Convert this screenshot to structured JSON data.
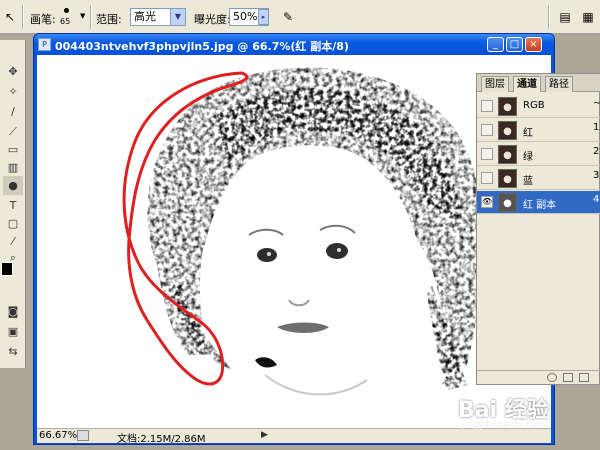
{
  "options_bar": {
    "brush_label": "画笔:",
    "brush_size": "65",
    "range_label": "范围:",
    "range_value": "高光",
    "exposure_label": "曝光度:",
    "exposure_value": "50%"
  },
  "document": {
    "title": "004403ntvehvf3phpvjln5.jpg @ 66.7%(红 副本/8)",
    "zoom": "66.67%",
    "doc_size": "文档:2.15M/2.86M"
  },
  "channels_panel": {
    "tabs": [
      {
        "label": "图层"
      },
      {
        "label": "通道"
      },
      {
        "label": "路径"
      }
    ],
    "active_tab": "通道",
    "channels": [
      {
        "name": "RGB",
        "shortcut": "~",
        "visible": false,
        "selected": false
      },
      {
        "name": "红",
        "shortcut": "1",
        "visible": false,
        "selected": false
      },
      {
        "name": "绿",
        "shortcut": "2",
        "visible": false,
        "selected": false
      },
      {
        "name": "蓝",
        "shortcut": "3",
        "visible": false,
        "selected": false
      },
      {
        "name": "红 副本",
        "shortcut": "4",
        "visible": true,
        "selected": true
      }
    ]
  },
  "watermark": {
    "text": "Bai 经验",
    "url": "jingyan.baidu.com"
  },
  "colors": {
    "selection": "#316ac5",
    "title_bar": "#0a5ae0",
    "annotation": "#e02020"
  }
}
